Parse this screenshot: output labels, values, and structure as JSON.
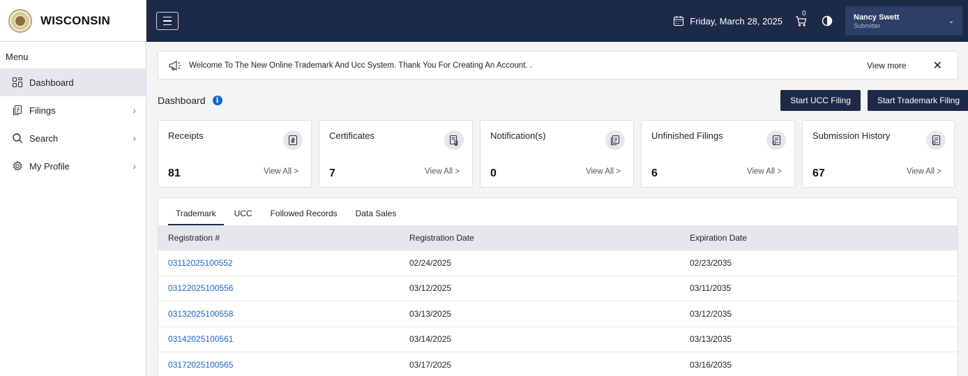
{
  "brand": {
    "name": "WISCONSIN"
  },
  "sidebar": {
    "menu_title": "Menu",
    "items": [
      {
        "label": "Dashboard",
        "icon": "dashboard-icon",
        "active": true
      },
      {
        "label": "Filings",
        "icon": "filings-icon"
      },
      {
        "label": "Search",
        "icon": "search-icon"
      },
      {
        "label": "My Profile",
        "icon": "settings-icon"
      }
    ]
  },
  "topbar": {
    "date": "Friday, March 28, 2025",
    "cart_count": "0",
    "user_name": "Nancy Swett",
    "user_role": "Submitter"
  },
  "banner": {
    "message": "Welcome To The New Online Trademark And Ucc System. Thank You For Creating An Account. .",
    "view_more": "View more",
    "close": "✕"
  },
  "dashboard": {
    "title": "Dashboard",
    "info": "i",
    "start_ucc": "Start UCC Filing",
    "start_trademark": "Start Trademark Filing"
  },
  "cards": [
    {
      "title": "Receipts",
      "count": "81",
      "link": "View All  >"
    },
    {
      "title": "Certificates",
      "count": "7",
      "link": "View All  >"
    },
    {
      "title": "Notification(s)",
      "count": "0",
      "link": "View All  >"
    },
    {
      "title": "Unfinished Filings",
      "count": "6",
      "link": "View All  >"
    },
    {
      "title": "Submission History",
      "count": "67",
      "link": "View All  >"
    }
  ],
  "tabs": [
    "Trademark",
    "UCC",
    "Followed Records",
    "Data Sales"
  ],
  "table": {
    "headers": [
      "Registration #",
      "Registration Date",
      "Expiration Date"
    ],
    "rows": [
      [
        "03112025100552",
        "02/24/2025",
        "02/23/2035"
      ],
      [
        "03122025100556",
        "03/12/2025",
        "03/11/2035"
      ],
      [
        "03132025100558",
        "03/13/2025",
        "03/12/2035"
      ],
      [
        "03142025100561",
        "03/14/2025",
        "03/13/2035"
      ],
      [
        "03172025100565",
        "03/17/2025",
        "03/16/2035"
      ]
    ]
  }
}
